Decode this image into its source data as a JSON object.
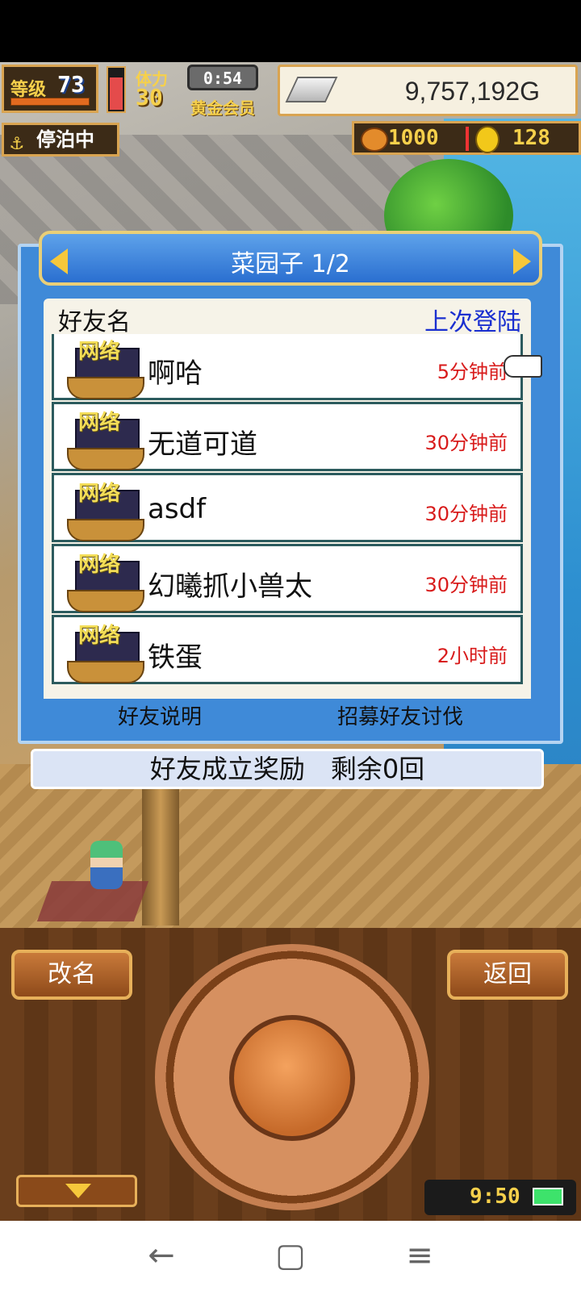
{
  "hud": {
    "level_label": "等级",
    "level_value": "73",
    "stamina_label": "体力",
    "stamina_value": "30",
    "timer": "0:54",
    "membership": "黄金会员",
    "money": "9,757,192G",
    "status": "停泊中",
    "wood": "1000",
    "coins": "128"
  },
  "dialog": {
    "title": "菜园子 1/2",
    "col_name": "好友名",
    "col_last_login": "上次登陆",
    "badge_text": "网络",
    "friends": [
      {
        "name": "啊哈",
        "last": "5分钟前"
      },
      {
        "name": "无道可道",
        "last": "30分钟前"
      },
      {
        "name": "asdf",
        "last": "30分钟前"
      },
      {
        "name": "幻曦抓小兽太",
        "last": "30分钟前"
      },
      {
        "name": "铁蛋",
        "last": "2小时前"
      }
    ],
    "btn_explain": "好友说明",
    "btn_recruit": "招募好友讨伐",
    "reward_text": "好友成立奖励　剩余0回"
  },
  "controls": {
    "rename": "改名",
    "back": "返回",
    "clock": "9:50"
  },
  "nav": {
    "back": "←",
    "home": "▢",
    "menu": "≡"
  },
  "colors": {
    "dialog_blue": "#3f8ad8",
    "time_red": "#d81b1b",
    "header_blue_text": "#1a2fd0",
    "gold": "#f6d04b"
  }
}
